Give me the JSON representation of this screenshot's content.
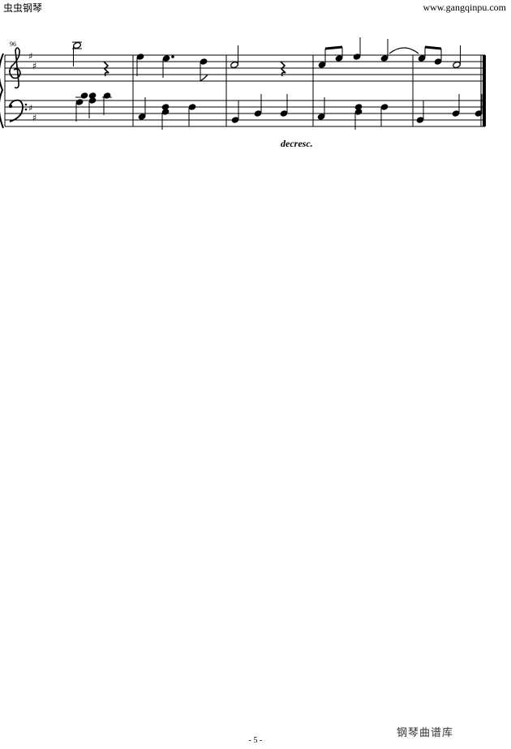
{
  "header": {
    "site_name": "虫虫钢琴",
    "site_url": "www.gangqinpu.com"
  },
  "score": {
    "measure_number": "96",
    "dynamic": "decresc.",
    "key_signature": "D major (2 sharps)",
    "clefs": [
      "treble",
      "bass"
    ],
    "measures": 5
  },
  "footer": {
    "page_number": "- 5 -",
    "watermark": "钢琴曲谱库"
  }
}
